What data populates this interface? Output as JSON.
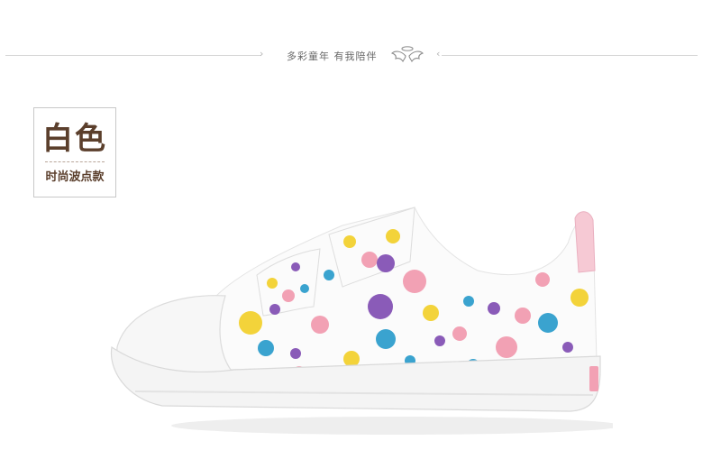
{
  "header": {
    "tagline": "多彩童年 有我陪伴",
    "left_chevron": "›",
    "right_chevron": "‹",
    "logo_icon": "angel-wings-halo-icon"
  },
  "label": {
    "color_name": "白色",
    "style_name": "时尚波点款"
  },
  "colors": {
    "brown_text": "#5b3f2c",
    "dot_yellow": "#f3d33a",
    "dot_blue": "#3aa3cf",
    "dot_purple": "#8a5bb8",
    "dot_pink": "#f2a1b4"
  },
  "product": {
    "image": "white-polka-dot-velcro-canvas-kids-shoe"
  }
}
